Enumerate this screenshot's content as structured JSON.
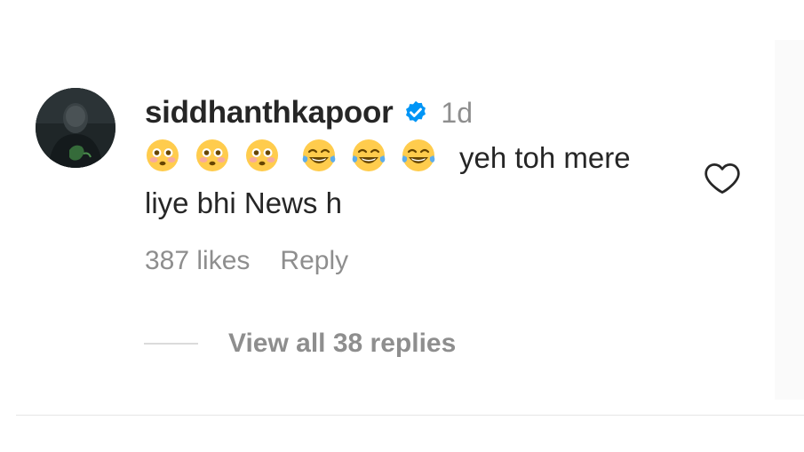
{
  "comment": {
    "username": "siddhanthkapoor",
    "verified": true,
    "time": "1d",
    "emojis": [
      "flushed-face-emoji",
      "flushed-face-emoji",
      "flushed-face-emoji",
      "tears-of-joy-emoji",
      "tears-of-joy-emoji",
      "tears-of-joy-emoji"
    ],
    "text": "yeh toh mere liye bhi News h",
    "likes": "387 likes",
    "reply_label": "Reply",
    "view_replies": "View all 38 replies"
  },
  "colors": {
    "text_primary": "#262626",
    "text_secondary": "#8e8e8e",
    "verified_blue": "#0095f6",
    "divider": "#e6e6e6"
  },
  "icons": {
    "verified": "verified-badge-icon",
    "like": "heart-outline-icon"
  }
}
